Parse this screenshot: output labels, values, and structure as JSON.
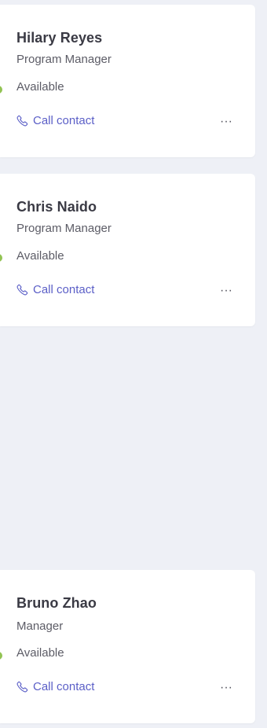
{
  "contacts": [
    {
      "name": "Hilary Reyes",
      "title": "Program Manager",
      "status": "Available",
      "call_label": "Call contact",
      "more_label": "···"
    },
    {
      "name": "Chris Naido",
      "title": "Program Manager",
      "status": "Available",
      "call_label": "Call contact",
      "more_label": "···"
    },
    {
      "name": "Bruno Zhao",
      "title": "Manager",
      "status": "Available",
      "call_label": "Call contact",
      "more_label": "···"
    }
  ],
  "colors": {
    "background": "#eef0f6",
    "card": "#ffffff",
    "accent": "#5b5fc7",
    "presence_available": "#92c353"
  },
  "icons": {
    "call": "phone-icon",
    "more": "more-options-icon",
    "presence": "presence-available-icon"
  }
}
